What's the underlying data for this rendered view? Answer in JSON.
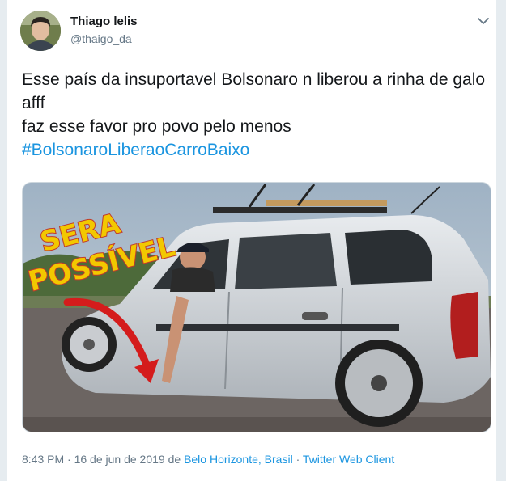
{
  "user": {
    "name": "Thiago lelis",
    "handle": "@thaigo_da"
  },
  "tweet": {
    "line1": "Esse país da insuportavel Bolsonaro n liberou a rinha de galo afff",
    "line2": "faz esse favor pro povo pelo menos",
    "hashtag": "#BolsonaroLiberaoCarroBaixo"
  },
  "photo": {
    "overlay_line1": "SERA",
    "overlay_line2": "POSSÍVEL"
  },
  "footer": {
    "time": "8:43 PM",
    "sep1": " · ",
    "date": "16 de jun de 2019",
    "de": " de ",
    "location": "Belo Horizonte, Brasil",
    "sep2": " · ",
    "client": "Twitter Web Client"
  },
  "icons": {
    "menu": "chevron-down-icon"
  },
  "colors": {
    "link": "#1b95e0",
    "text": "#14171a",
    "muted": "#657786"
  }
}
